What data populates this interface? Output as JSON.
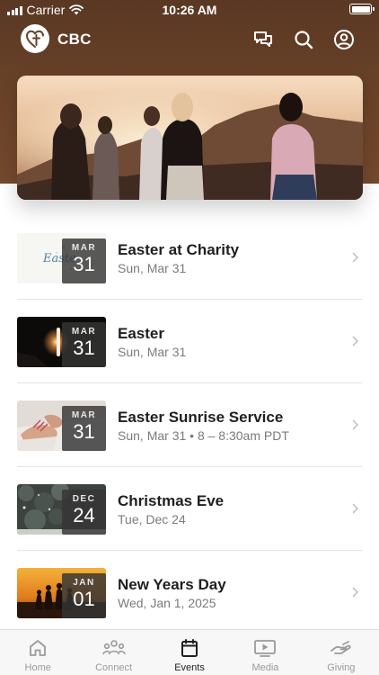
{
  "status_bar": {
    "carrier": "Carrier",
    "time": "10:26 AM"
  },
  "app": {
    "title": "CBC"
  },
  "icons": {
    "messages": "chat-bubbles-icon",
    "search": "search-icon",
    "profile": "profile-icon"
  },
  "events": [
    {
      "month": "MAR",
      "day": "31",
      "title": "Easter at Charity",
      "subtitle": "Sun, Mar 31",
      "thumb_text": "Easte"
    },
    {
      "month": "MAR",
      "day": "31",
      "title": "Easter",
      "subtitle": "Sun, Mar 31"
    },
    {
      "month": "MAR",
      "day": "31",
      "title": "Easter Sunrise Service",
      "subtitle": "Sun, Mar 31 • 8 – 8:30am PDT"
    },
    {
      "month": "DEC",
      "day": "24",
      "title": "Christmas Eve",
      "subtitle": "Tue, Dec 24"
    },
    {
      "month": "JAN",
      "day": "01",
      "title": "New Years Day",
      "subtitle": "Wed, Jan 1, 2025"
    }
  ],
  "tabs": [
    {
      "label": "Home",
      "icon": "home-icon"
    },
    {
      "label": "Connect",
      "icon": "people-icon"
    },
    {
      "label": "Events",
      "icon": "calendar-icon",
      "active": true
    },
    {
      "label": "Media",
      "icon": "play-icon"
    },
    {
      "label": "Giving",
      "icon": "giving-hand-icon"
    }
  ],
  "colors": {
    "header": "#6b4329",
    "accent_text": "#1f1f1f",
    "muted_text": "#7b7b7b",
    "tab_inactive": "#9a9a9a"
  }
}
